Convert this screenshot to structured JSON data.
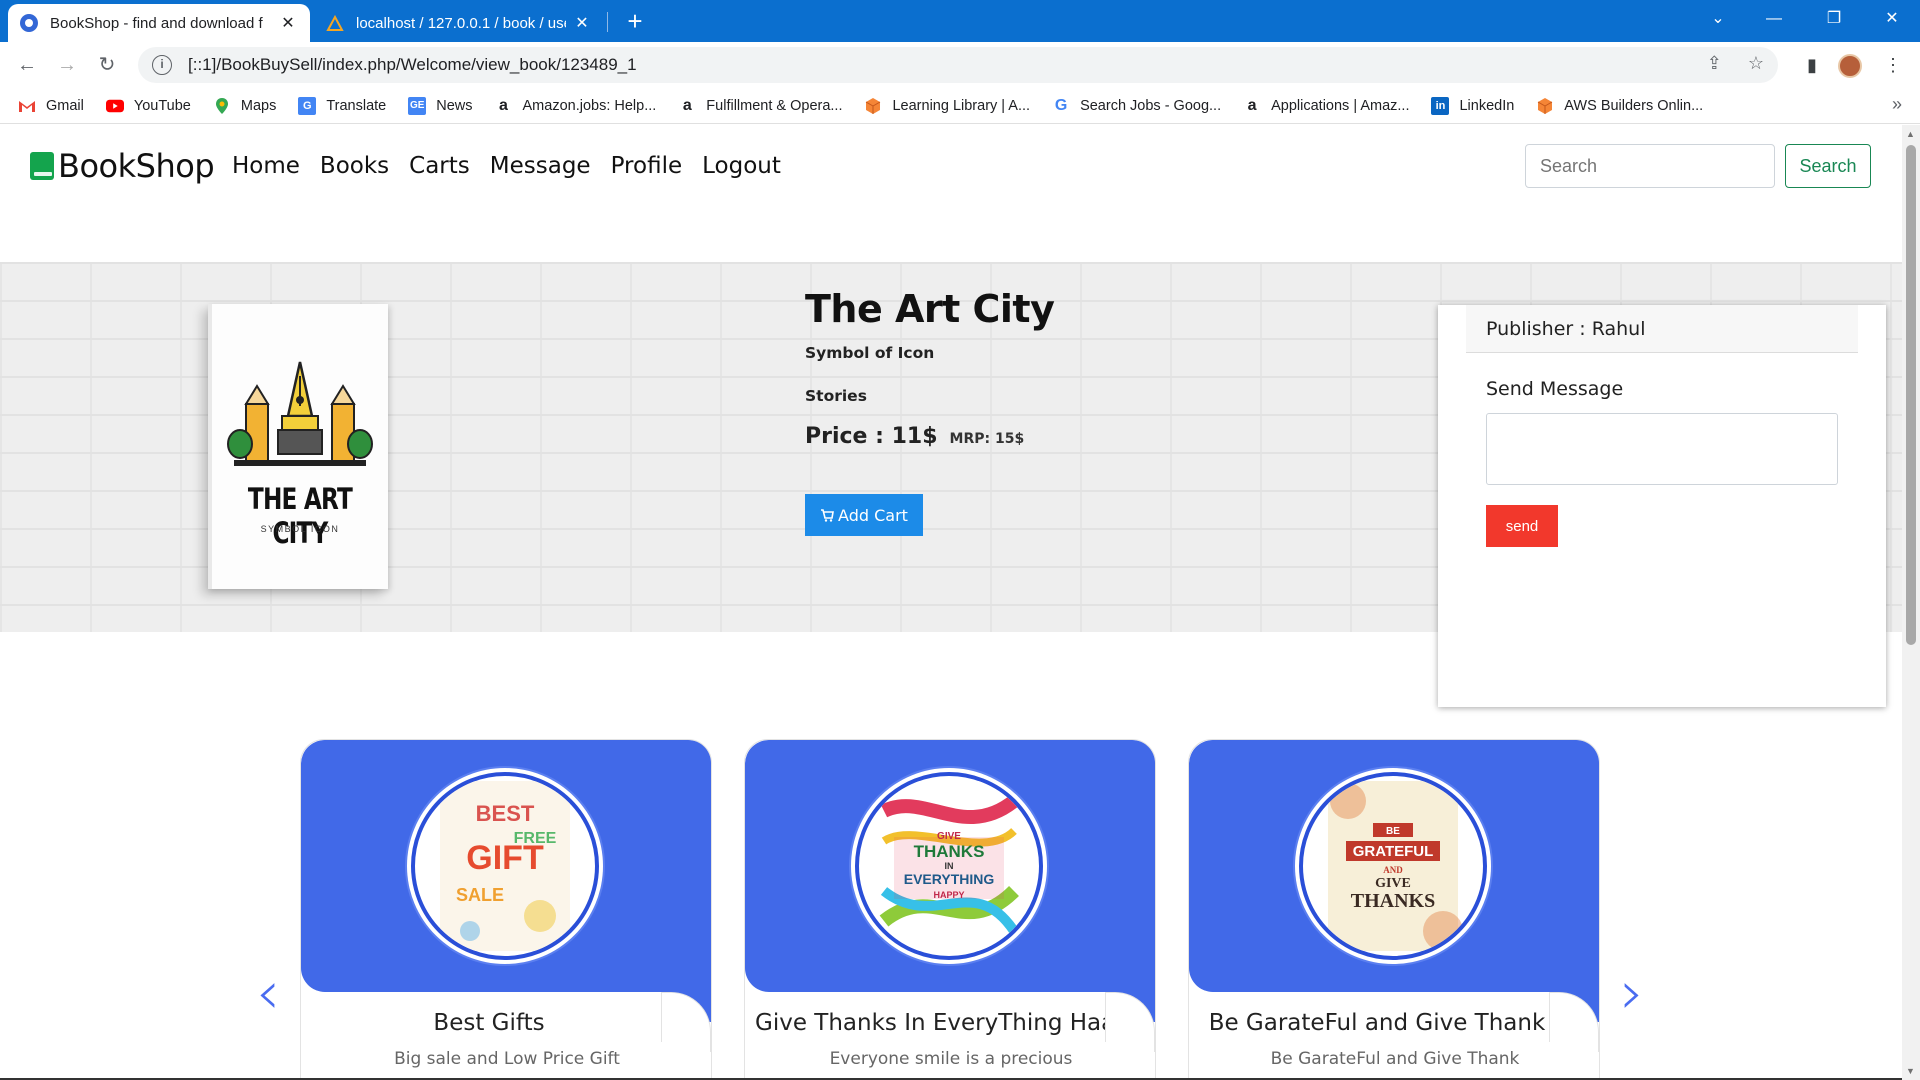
{
  "browser": {
    "tabs": [
      {
        "title": "BookShop - find and download f",
        "active": true
      },
      {
        "title": "localhost / 127.0.0.1 / book / use",
        "active": false
      }
    ],
    "url": "[::1]/BookBuySell/index.php/Welcome/view_book/123489_1",
    "bookmarks": [
      {
        "label": "Gmail",
        "icon": "gmail-icon",
        "color": "#ea4335"
      },
      {
        "label": "YouTube",
        "icon": "youtube-icon",
        "color": "#ff0000"
      },
      {
        "label": "Maps",
        "icon": "maps-icon",
        "color": "#34a853"
      },
      {
        "label": "Translate",
        "icon": "translate-icon",
        "color": "#4285f4"
      },
      {
        "label": "News",
        "icon": "news-icon",
        "color": "#4285f4"
      },
      {
        "label": "Amazon.jobs: Help...",
        "icon": "amazon-icon",
        "color": "#000000"
      },
      {
        "label": "Fulfillment & Opera...",
        "icon": "amazon-icon",
        "color": "#000000"
      },
      {
        "label": "Learning Library | A...",
        "icon": "aws-cube-icon",
        "color": "#f58536"
      },
      {
        "label": "Search Jobs - Goog...",
        "icon": "google-icon",
        "color": "#4285f4"
      },
      {
        "label": "Applications | Amaz...",
        "icon": "amazon-icon",
        "color": "#000000"
      },
      {
        "label": "LinkedIn",
        "icon": "linkedin-icon",
        "color": "#0a66c2"
      },
      {
        "label": "AWS Builders Onlin...",
        "icon": "aws-cube-icon",
        "color": "#f58536"
      }
    ]
  },
  "site": {
    "brand": "BookShop",
    "nav": [
      "Home",
      "Books",
      "Carts",
      "Message",
      "Profile",
      "Logout"
    ],
    "search_placeholder": "Search",
    "search_button": "Search",
    "accent_color": "#198754"
  },
  "book": {
    "cover_title": "THE ART CITY",
    "cover_subtitle": "SYMBOL ICON",
    "title": "The Art City",
    "author": "Symbol of Icon",
    "category": "Stories",
    "price": "Price : 11$",
    "mrp": "MRP: 15$",
    "add_cart": "Add Cart"
  },
  "message_panel": {
    "publisher": "Publisher : Rahul",
    "label": "Send Message",
    "textarea_value": "",
    "send": "send"
  },
  "carousel": {
    "prev": "‹",
    "next": "›",
    "cards": [
      {
        "title": "Best Gifts",
        "desc": "Big sale and Low Price Gift",
        "art": [
          "BEST",
          "GIFT",
          "SALE",
          "FREE"
        ]
      },
      {
        "title": "Give Thanks In EveryThing Haap",
        "desc": "Everyone smile is a precious",
        "art": [
          "GIVE",
          "THANKS",
          "IN",
          "EVERYTHING",
          "HAPPY"
        ]
      },
      {
        "title": "Be GarateFul and Give Thank",
        "desc": "Be GarateFul and Give Thank",
        "art": [
          "BE",
          "GRATEFUL",
          "AND",
          "GIVE",
          "THANKS"
        ]
      }
    ]
  }
}
